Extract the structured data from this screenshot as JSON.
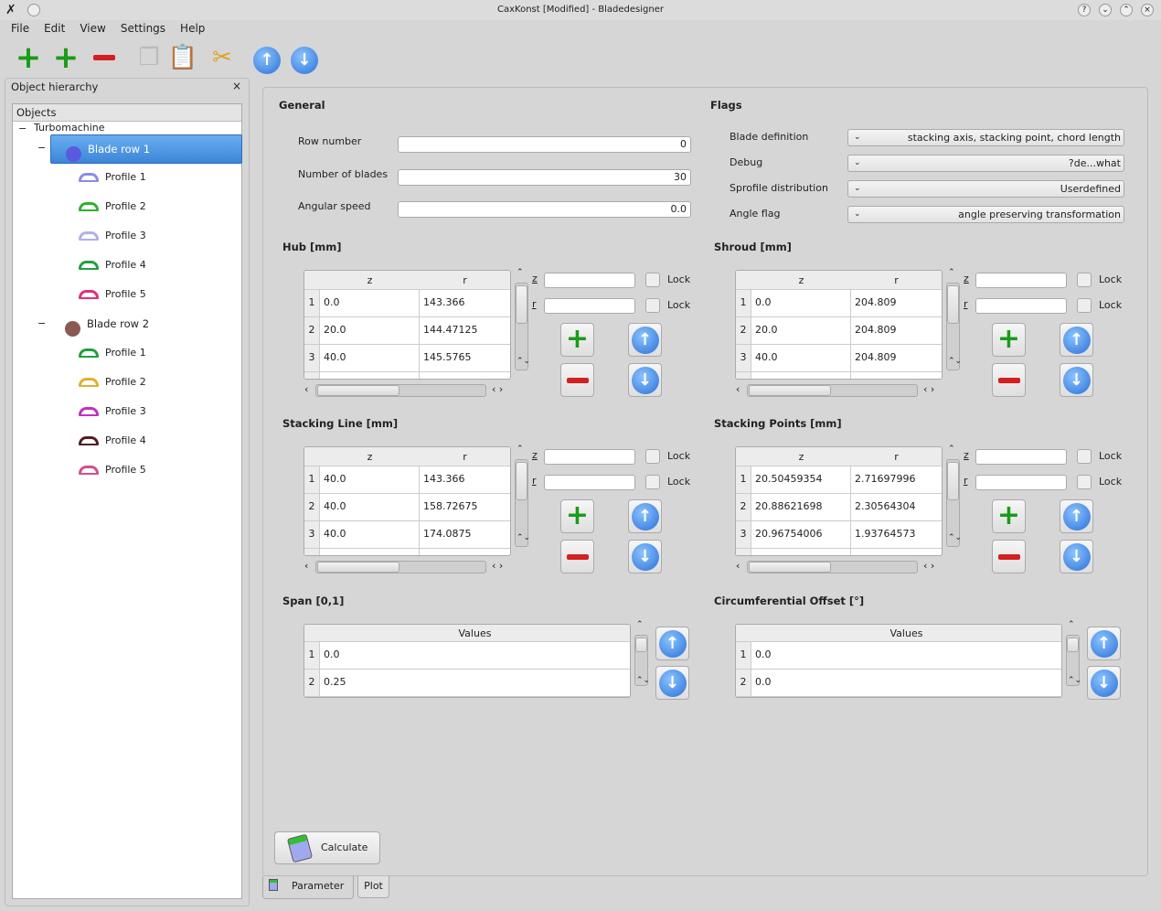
{
  "window": {
    "title": "CaxKonst [Modified] - Bladedesigner"
  },
  "menu": [
    "File",
    "Edit",
    "View",
    "Settings",
    "Help"
  ],
  "toolbar": [
    {
      "name": "add-blade-row-icon",
      "glyph": "+",
      "color": "#1a9b1a"
    },
    {
      "name": "add-profile-icon",
      "glyph": "+",
      "color": "#1a9b1a"
    },
    {
      "name": "remove-icon",
      "glyph": "−",
      "color": "#d42020"
    },
    {
      "name": "copy-icon",
      "glyph": "❐",
      "color": "#bbbbbb"
    },
    {
      "name": "paste-icon",
      "glyph": "📋",
      "color": "#e0a020"
    },
    {
      "name": "cut-icon",
      "glyph": "✂",
      "color": "#e0a020"
    },
    {
      "name": "move-up-icon",
      "glyph": "↑",
      "color": "#2a6fd6"
    },
    {
      "name": "move-down-icon",
      "glyph": "↓",
      "color": "#2a6fd6"
    }
  ],
  "dock": {
    "title": "Object hierarchy",
    "close": "×",
    "header": "Objects"
  },
  "tree": {
    "root": "Turbomachine",
    "rows": [
      {
        "label": "Blade row 1",
        "color": "#5a5ae0",
        "selected": true,
        "profiles": [
          {
            "label": "Profile 1",
            "color": "#8a8ae8"
          },
          {
            "label": "Profile 2",
            "color": "#30b030"
          },
          {
            "label": "Profile 3",
            "color": "#b0b0e8"
          },
          {
            "label": "Profile 4",
            "color": "#20a040"
          },
          {
            "label": "Profile 5",
            "color": "#e0307a"
          }
        ]
      },
      {
        "label": "Blade row 2",
        "color": "#8a5a50",
        "selected": false,
        "profiles": [
          {
            "label": "Profile 1",
            "color": "#20a040"
          },
          {
            "label": "Profile 2",
            "color": "#e0b030"
          },
          {
            "label": "Profile 3",
            "color": "#c030c0"
          },
          {
            "label": "Profile 4",
            "color": "#502020"
          },
          {
            "label": "Profile 5",
            "color": "#d05090"
          }
        ]
      }
    ]
  },
  "general": {
    "title": "General",
    "fields": [
      {
        "label": "Row number",
        "value": "0"
      },
      {
        "label": "Number of blades",
        "value": "30"
      },
      {
        "label": "Angular speed",
        "value": "0.0"
      }
    ]
  },
  "flags": {
    "title": "Flags",
    "fields": [
      {
        "label": "Blade definition",
        "value": "stacking axis, stacking point, chord length"
      },
      {
        "label": "Debug",
        "value": "?de...what"
      },
      {
        "label": "Sprofile distribution",
        "value": "Userdefined"
      },
      {
        "label": "Angle flag",
        "value": "angle preserving transformation"
      }
    ]
  },
  "grids": [
    {
      "title": "Hub [mm]",
      "cols": [
        "z",
        "r"
      ],
      "rows": [
        [
          "0.0",
          "143.366"
        ],
        [
          "20.0",
          "144.47125"
        ],
        [
          "40.0",
          "145.5765"
        ]
      ],
      "z_label": "z",
      "r_label": "r",
      "lock": "Lock"
    },
    {
      "title": "Shroud [mm]",
      "cols": [
        "z",
        "r"
      ],
      "rows": [
        [
          "0.0",
          "204.809"
        ],
        [
          "20.0",
          "204.809"
        ],
        [
          "40.0",
          "204.809"
        ]
      ],
      "z_label": "z",
      "r_label": "r",
      "lock": "Lock"
    },
    {
      "title": "Stacking Line [mm]",
      "cols": [
        "z",
        "r"
      ],
      "rows": [
        [
          "40.0",
          "143.366"
        ],
        [
          "40.0",
          "158.72675"
        ],
        [
          "40.0",
          "174.0875"
        ]
      ],
      "z_label": "z",
      "r_label": "r",
      "lock": "Lock"
    },
    {
      "title": "Stacking Points [mm]",
      "cols": [
        "z",
        "r"
      ],
      "rows": [
        [
          "20.50459354",
          "2.71697996"
        ],
        [
          "20.88621698",
          "2.30564304"
        ],
        [
          "20.96754006",
          "1.93764573"
        ]
      ],
      "z_label": "z",
      "r_label": "r",
      "lock": "Lock"
    }
  ],
  "lists": [
    {
      "title": "Span [0,1]",
      "col": "Values",
      "rows": [
        "0.0",
        "0.25"
      ]
    },
    {
      "title": "Circumferential Offset [°]",
      "col": "Values",
      "rows": [
        "0.0",
        "0.0"
      ]
    }
  ],
  "calculate_label": "Calculate",
  "tabs": [
    {
      "label": "Parameter",
      "active": true
    },
    {
      "label": "Plot",
      "active": false
    }
  ]
}
